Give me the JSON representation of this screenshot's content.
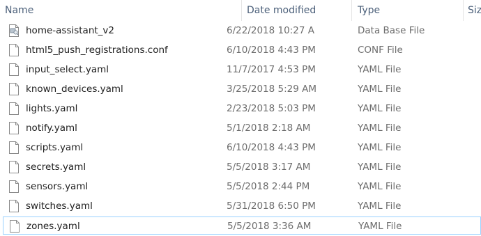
{
  "columns": {
    "name": "Name",
    "date_modified": "Date modified",
    "type": "Type",
    "size": "Siz"
  },
  "files": [
    {
      "name": "home-assistant_v2",
      "date": "6/22/2018 10:27 A",
      "type": "Data Base File",
      "icon": "database-file-icon"
    },
    {
      "name": "html5_push_registrations.conf",
      "date": "6/10/2018 4:43 PM",
      "type": "CONF File",
      "icon": "document-icon"
    },
    {
      "name": "input_select.yaml",
      "date": "11/7/2017 4:53 PM",
      "type": "YAML File",
      "icon": "document-icon"
    },
    {
      "name": "known_devices.yaml",
      "date": "3/25/2018 5:29 AM",
      "type": "YAML File",
      "icon": "document-icon"
    },
    {
      "name": "lights.yaml",
      "date": "2/23/2018 5:03 PM",
      "type": "YAML File",
      "icon": "document-icon"
    },
    {
      "name": "notify.yaml",
      "date": "5/1/2018 2:18 AM",
      "type": "YAML File",
      "icon": "document-icon"
    },
    {
      "name": "scripts.yaml",
      "date": "6/10/2018 4:43 PM",
      "type": "YAML File",
      "icon": "document-icon"
    },
    {
      "name": "secrets.yaml",
      "date": "5/5/2018 3:17 AM",
      "type": "YAML File",
      "icon": "document-icon"
    },
    {
      "name": "sensors.yaml",
      "date": "5/5/2018 2:44 PM",
      "type": "YAML File",
      "icon": "document-icon"
    },
    {
      "name": "switches.yaml",
      "date": "5/31/2018 6:50 PM",
      "type": "YAML File",
      "icon": "document-icon"
    },
    {
      "name": "zones.yaml",
      "date": "5/5/2018 3:36 AM",
      "type": "YAML File",
      "icon": "document-icon",
      "focused": true
    }
  ],
  "colors": {
    "header_text": "#4c607a",
    "focus_border": "#99d1ff",
    "secondary_text": "#6d6d6d"
  }
}
